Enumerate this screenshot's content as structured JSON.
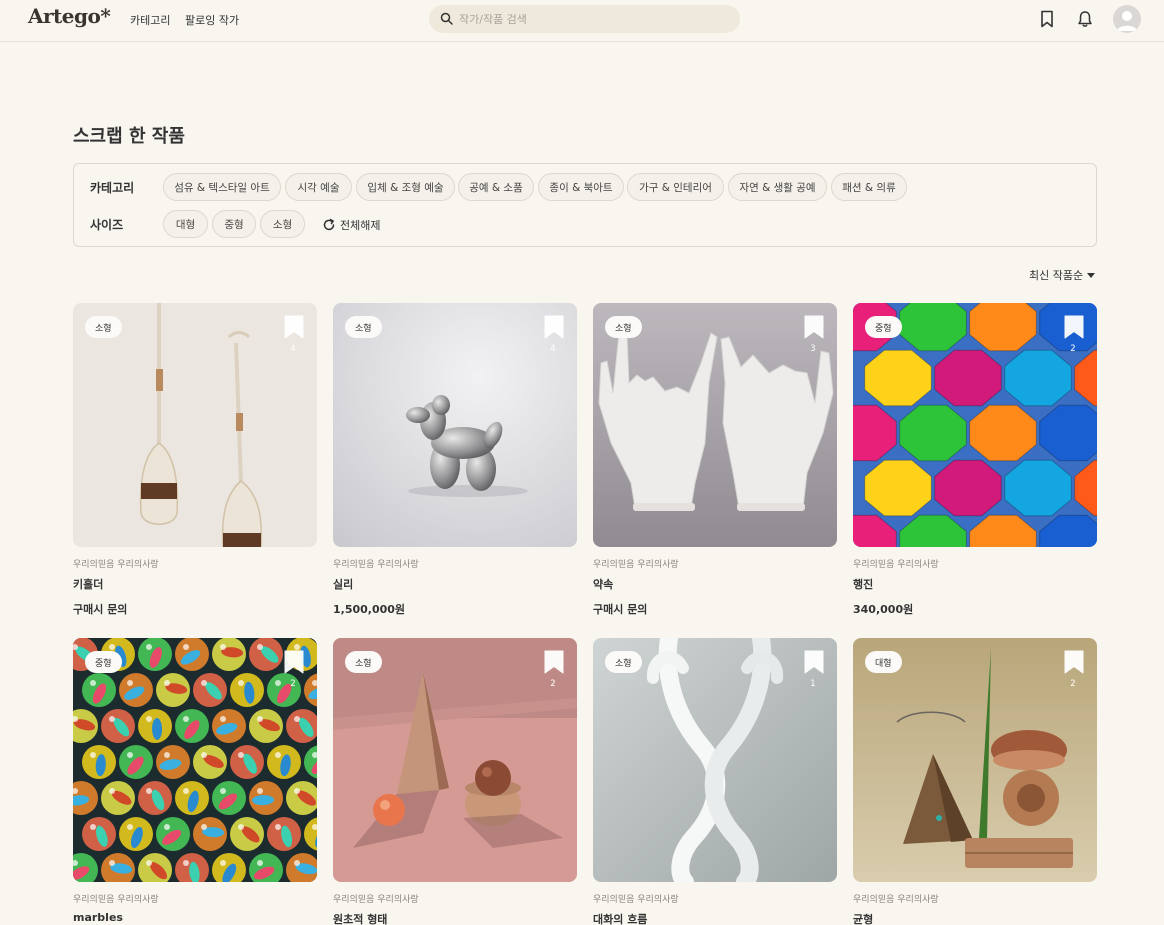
{
  "header": {
    "logo": "Artego*",
    "nav": [
      "카테고리",
      "팔로잉 작가"
    ],
    "search_placeholder": "작가/작품 검색"
  },
  "page_title": "스크랩 한 작품",
  "filters": {
    "category_label": "카테고리",
    "categories": [
      "섬유 & 텍스타일 아트",
      "시각 예술",
      "입체 & 조형 예술",
      "공예 & 소품",
      "종이 & 북아트",
      "가구 & 인테리어",
      "자연 & 생활 공예",
      "패션 & 의류"
    ],
    "size_label": "사이즈",
    "sizes": [
      "대형",
      "중형",
      "소형"
    ],
    "reset_label": "전체해제"
  },
  "sort": "최신 작품순",
  "works": [
    {
      "size": "소형",
      "count": "4",
      "artist": "우리의믿음 우리의사랑",
      "title": "키홀더",
      "price": "구매시 문의"
    },
    {
      "size": "소형",
      "count": "4",
      "artist": "우리의믿음 우리의사랑",
      "title": "실리",
      "price": "1,500,000원"
    },
    {
      "size": "소형",
      "count": "3",
      "artist": "우리의믿음 우리의사랑",
      "title": "약속",
      "price": "구매시 문의"
    },
    {
      "size": "중형",
      "count": "2",
      "artist": "우리의믿음 우리의사랑",
      "title": "행진",
      "price": "340,000원"
    },
    {
      "size": "중형",
      "count": "2",
      "artist": "우리의믿음 우리의사랑",
      "title": "marbles",
      "price": ""
    },
    {
      "size": "소형",
      "count": "2",
      "artist": "우리의믿음 우리의사랑",
      "title": "원초적 형태",
      "price": ""
    },
    {
      "size": "소형",
      "count": "1",
      "artist": "우리의믿음 우리의사랑",
      "title": "대화의 흐름",
      "price": ""
    },
    {
      "size": "대형",
      "count": "2",
      "artist": "우리의믿음 우리의사랑",
      "title": "균형",
      "price": ""
    }
  ]
}
